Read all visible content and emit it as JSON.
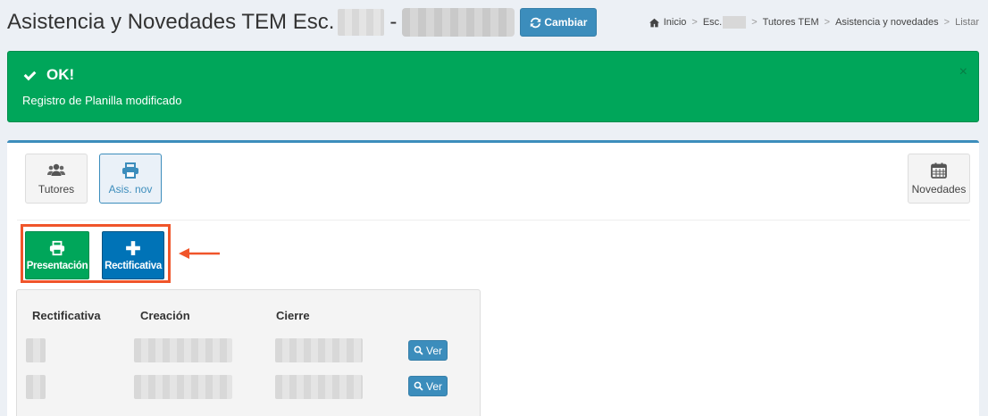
{
  "header": {
    "title": "Asistencia y Novedades TEM Esc.",
    "separator": "-",
    "cambiar_label": "Cambiar"
  },
  "breadcrumb": {
    "items": [
      "Inicio",
      "Esc.",
      "Tutores TEM",
      "Asistencia y novedades",
      "Listar"
    ]
  },
  "alert": {
    "title": "OK!",
    "message": "Registro de Planilla modificado",
    "close": "×"
  },
  "toolbar": {
    "tutores_label": "Tutores",
    "asis_label": "Asis. nov",
    "novedades_label": "Novedades"
  },
  "actions": {
    "presentacion_label": "Presentación",
    "rectificativa_label": "Rectificativa"
  },
  "table": {
    "headers": [
      "Rectificativa",
      "Creación",
      "Cierre"
    ],
    "rows": [
      {
        "ver_label": "Ver"
      },
      {
        "ver_label": "Ver"
      }
    ]
  },
  "colors": {
    "primary": "#3c8dbc",
    "success": "#00a65a",
    "action_blue": "#0073b7",
    "highlight": "#f0552a"
  }
}
